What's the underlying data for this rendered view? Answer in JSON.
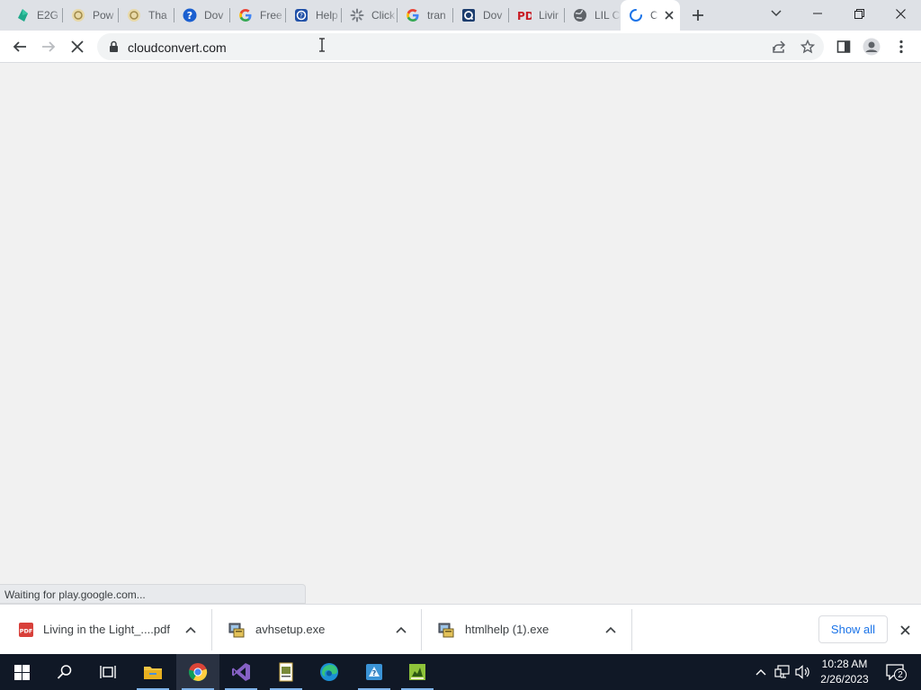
{
  "browser": {
    "tabs": [
      {
        "title": "E2G",
        "icon": "e2g-favicon-icon"
      },
      {
        "title": "Pow",
        "icon": "pow-favicon-icon"
      },
      {
        "title": "Tha",
        "icon": "tha-favicon-icon"
      },
      {
        "title": "Dov",
        "icon": "dov-favicon-icon"
      },
      {
        "title": "Free",
        "icon": "google-favicon-icon"
      },
      {
        "title": "Help",
        "icon": "help-favicon-icon"
      },
      {
        "title": "Click",
        "icon": "click-favicon-icon"
      },
      {
        "title": "tran",
        "icon": "google-favicon-icon"
      },
      {
        "title": "Dov",
        "icon": "dov-dark-favicon-icon"
      },
      {
        "title": "Livir",
        "icon": "pdf-favicon-icon"
      },
      {
        "title": "LIL C",
        "icon": "globe-favicon-icon"
      },
      {
        "title": "C",
        "icon": "loading-spinner-icon",
        "active": true
      }
    ],
    "address": "cloudconvert.com",
    "status_text": "Waiting for play.google.com..."
  },
  "downloads": {
    "items": [
      {
        "name": "Living in the Light_....pdf",
        "icon": "pdf-file-icon"
      },
      {
        "name": "avhsetup.exe",
        "icon": "installer-file-icon"
      },
      {
        "name": "htmlhelp (1).exe",
        "icon": "installer-file-icon"
      }
    ],
    "show_all_label": "Show all"
  },
  "taskbar": {
    "time": "10:28 AM",
    "date": "2/26/2023",
    "notification_count": "2"
  },
  "colors": {
    "accent": "#1a73e8",
    "tabstrip": "#dee1e6",
    "taskbar": "#101826"
  }
}
